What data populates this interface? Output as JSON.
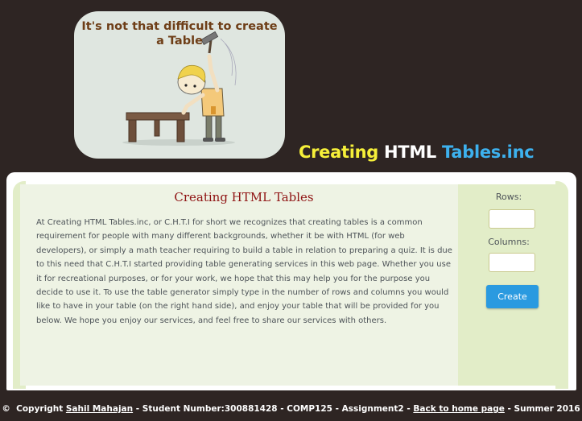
{
  "banner": {
    "title": "It's not that difficult to create a Table"
  },
  "site_title": {
    "part1": "Creating",
    "part2": "HTML",
    "part3": "Tables.inc"
  },
  "main": {
    "heading": "Creating HTML Tables",
    "body": "At Creating HTML Tables.inc, or C.H.T.I for short we recognizes that creating tables is a common requirement for people with many different backgrounds, whether it be with HTML (for web developers), or simply a math teacher requiring to build a table in relation to preparing a quiz. It is due to this need that C.H.T.I started providing table generating services in this web page. Whether you use it for recreational purposes, or for your work, we hope that this may help you for the purpose you decide to use it. To use the table generator simply type in the number of rows and columns you would like to have in your table (on the right hand side), and enjoy your table that will be provided for you below. We hope you enjoy our services, and feel free to share our services with others."
  },
  "sidebar": {
    "rows_label": "Rows:",
    "columns_label": "Columns:",
    "rows_value": "",
    "columns_value": "",
    "create_label": "Create"
  },
  "footer": {
    "copyright_symbol": "©",
    "copyright_text": "Copyright",
    "author": "Sahil Mahajan",
    "student_info": "- Student Number:300881428 - COMP125 - Assignment2 -",
    "home_link": "Back to home page",
    "term": "- Summer 2016"
  },
  "colors": {
    "background": "#2e2523",
    "accent_yellow": "#f6f039",
    "accent_blue": "#3db1ee",
    "heading_red": "#8f1313",
    "button_blue": "#2a9ae0"
  }
}
